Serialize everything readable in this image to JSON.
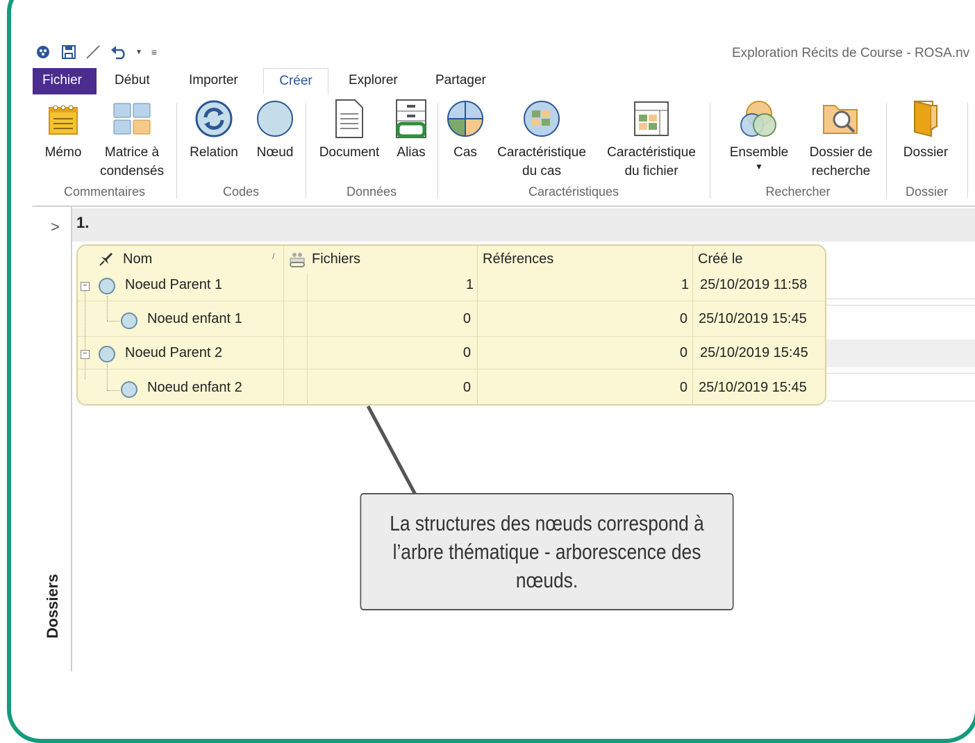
{
  "window": {
    "title": "Exploration Récits de Course - ROSA.nv"
  },
  "tabs": [
    "Fichier",
    "Début",
    "Importer",
    "Créer",
    "Explorer",
    "Partager"
  ],
  "ribbon": {
    "buttons": {
      "memo": "Mémo",
      "matrice": "Matrice à condensés",
      "relation": "Relation",
      "noeud": "Nœud",
      "document": "Document",
      "alias": "Alias",
      "cas": "Cas",
      "carac_cas": "Caractéristique du cas",
      "carac_fichier": "Caractéristique du fichier",
      "ensemble": "Ensemble",
      "dossier_recherche": "Dossier de recherche",
      "dossier": "Dossier"
    },
    "groups": {
      "commentaires": "Commentaires",
      "codes": "Codes",
      "donnees": "Données",
      "caracteristiques": "Caractéristiques",
      "rechercher": "Rechercher",
      "dossier": "Dossier"
    }
  },
  "rail": {
    "label": "Dossiers",
    "arrow": ">"
  },
  "breadcrumb": "1.",
  "table": {
    "headers": {
      "nom": "Nom",
      "fichiers": "Fichiers",
      "references": "Références",
      "cree": "Créé le"
    },
    "rows": [
      {
        "nom": "Noeud Parent 1",
        "fichiers": "1",
        "references": "1",
        "cree": "25/10/2019 11:58"
      },
      {
        "nom": "Noeud enfant 1",
        "fichiers": "0",
        "references": "0",
        "cree": "25/10/2019 15:45"
      },
      {
        "nom": "Noeud Parent 2",
        "fichiers": "0",
        "references": "0",
        "cree": "25/10/2019 15:45"
      },
      {
        "nom": "Noeud enfant 2",
        "fichiers": "0",
        "references": "0",
        "cree": "25/10/2019 15:45"
      }
    ]
  },
  "callout": {
    "text": "La structures des nœuds correspond à l’arbre thématique - arborescence des nœuds."
  },
  "colors": {
    "frame": "#159a7c",
    "file_tab": "#4b2c8f",
    "grid_bg": "#fbf6d3"
  }
}
